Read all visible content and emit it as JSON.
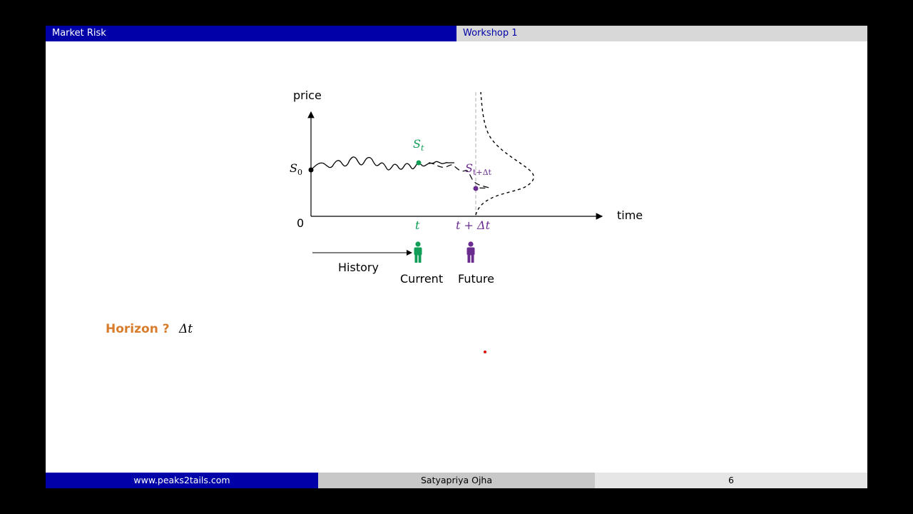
{
  "header": {
    "left_title": "Market Risk",
    "right_title": "Workshop 1"
  },
  "diagram": {
    "y_axis_label": "price",
    "x_axis_label": "time",
    "origin_label": "0",
    "s0_label": "S",
    "s0_sub": "0",
    "st_label": "S",
    "st_sub": "t",
    "sf_label": "S",
    "sf_sub": "t+Δt",
    "t_tick": "t",
    "tdt_tick": "t + Δt",
    "history_label": "History",
    "current_label": "Current",
    "future_label": "Future",
    "colors": {
      "current": "#0f9d58",
      "future": "#6a2c8f",
      "axis": "#000000"
    },
    "icons": [
      "person-icon-current",
      "person-icon-future"
    ]
  },
  "body": {
    "horizon_label": "Horizon ?",
    "horizon_value": "Δt",
    "horizon_color": "#d97c2b"
  },
  "footer": {
    "website": "www.peaks2tails.com",
    "author": "Satyapriya Ojha",
    "page_number": "6"
  }
}
